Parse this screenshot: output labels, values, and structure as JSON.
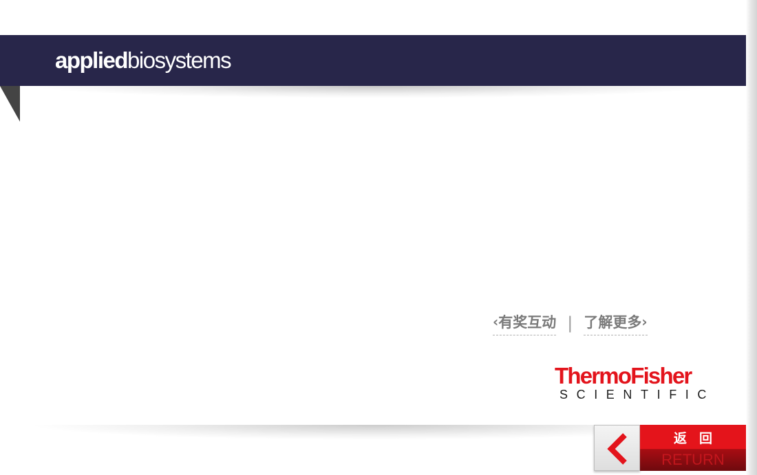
{
  "header": {
    "brand_bold": "applied",
    "brand_light": "biosystems"
  },
  "links": {
    "left_label": "有奖互动",
    "right_label": "了解更多",
    "separator": "|",
    "left_chevron": "‹",
    "right_chevron": "›"
  },
  "logo": {
    "line1": "ThermoFisher",
    "line2": "SCIENTIFIC"
  },
  "return_button": {
    "label_cn": "返回",
    "label_en": "RETURN"
  },
  "colors": {
    "header_band": "#28264a",
    "thermo_red": "#e3141c",
    "return_red": "#e4141b",
    "link_gray": "#7a7a7a"
  }
}
